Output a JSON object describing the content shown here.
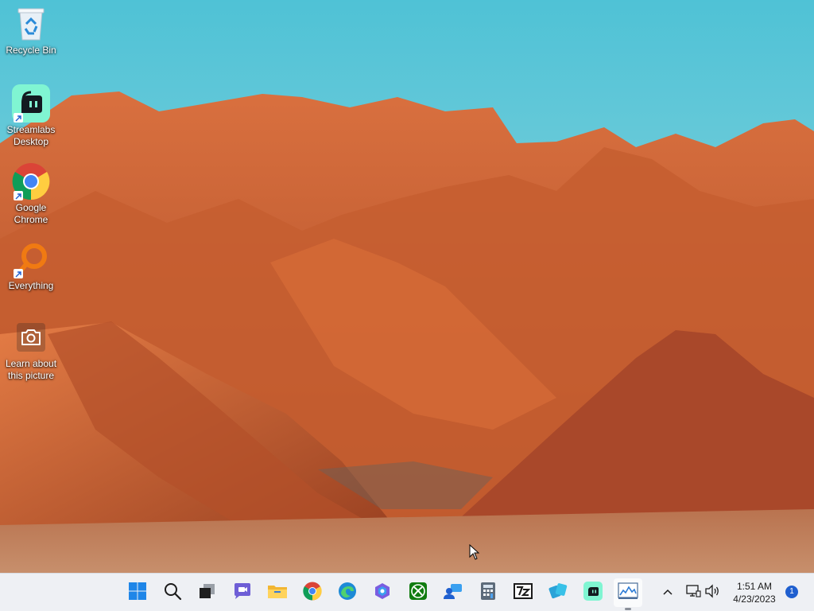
{
  "desktop": {
    "icons": [
      {
        "label": "Recycle Bin"
      },
      {
        "label": "Streamlabs\nDesktop"
      },
      {
        "label": "Google\nChrome"
      },
      {
        "label": "Everything"
      },
      {
        "label": "Learn about\nthis picture"
      }
    ]
  },
  "taskbar": {
    "apps": [
      {
        "icon": "windows-start-icon"
      },
      {
        "icon": "search-icon"
      },
      {
        "icon": "task-view-icon"
      },
      {
        "icon": "teams-chat-icon"
      },
      {
        "icon": "file-explorer-icon"
      },
      {
        "icon": "chrome-icon"
      },
      {
        "icon": "edge-icon"
      },
      {
        "icon": "copilot-icon"
      },
      {
        "icon": "xbox-icon"
      },
      {
        "icon": "people-icon"
      },
      {
        "icon": "calculator-icon"
      },
      {
        "icon": "7zip-icon"
      },
      {
        "icon": "settings-sync-icon"
      },
      {
        "icon": "streamlabs-icon"
      },
      {
        "icon": "resource-monitor-icon"
      }
    ],
    "tray": {
      "time": "1:51 AM",
      "date": "4/23/2023",
      "notification_count": "1"
    }
  },
  "colors": {
    "taskbar_bg": "#eef0f4",
    "accent": "#1f5fcf",
    "streamlabs_green": "#80f5d2"
  }
}
